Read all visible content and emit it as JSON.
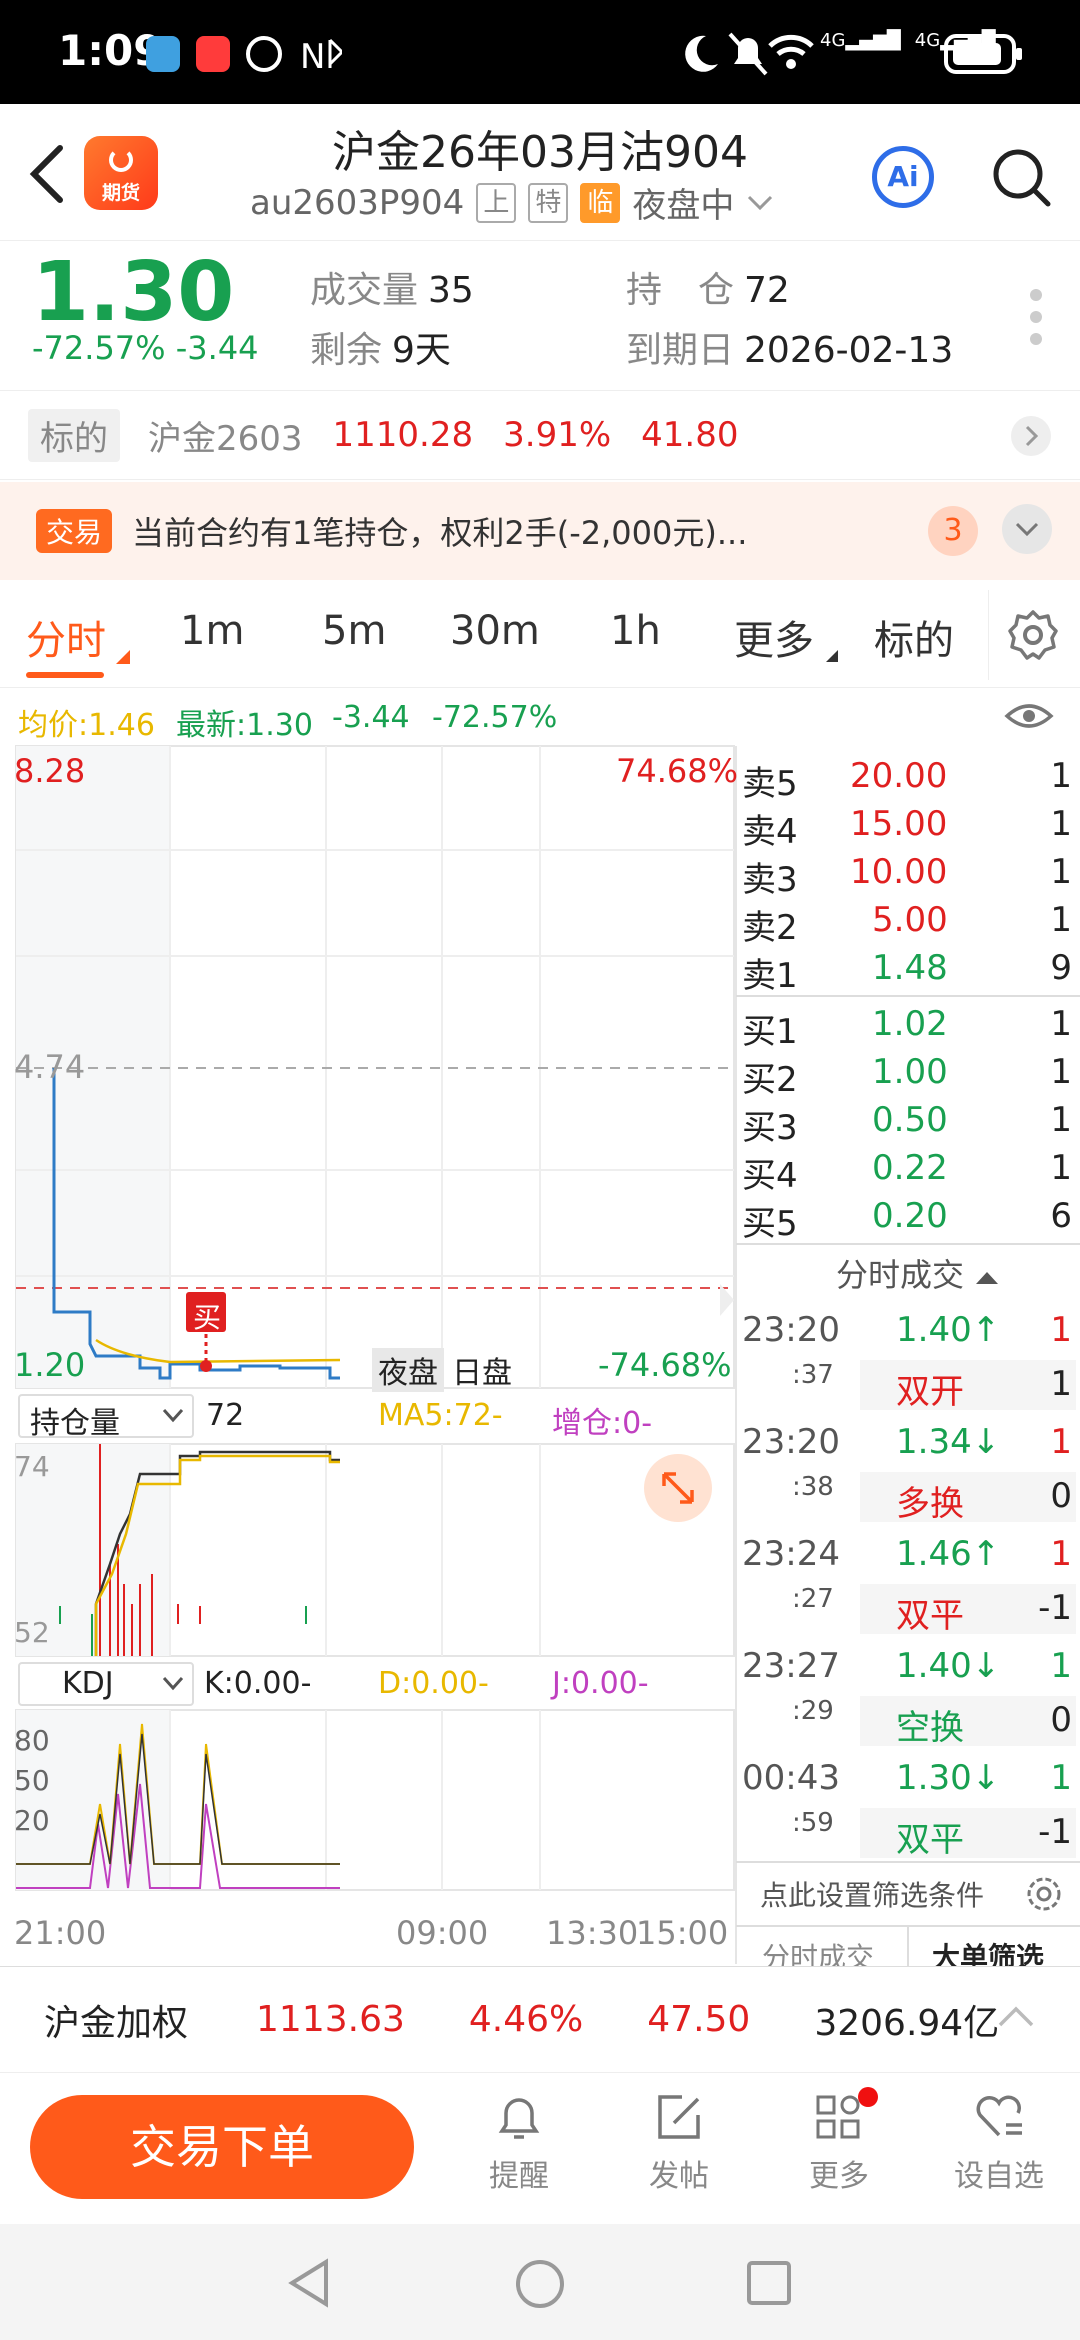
{
  "status_bar": {
    "time": "1:09",
    "net_labels": [
      "4G",
      "4G"
    ]
  },
  "header": {
    "logo_label": "期货",
    "title": "沪金26年03月沽904",
    "code": "au2603P904",
    "tags": [
      "上",
      "特",
      "临"
    ],
    "session": "夜盘中",
    "ai_label": "Ai"
  },
  "quote": {
    "price": "1.30",
    "change_pct": "-72.57%",
    "change": "-3.44",
    "volume_label": "成交量",
    "volume": "35",
    "remain_label": "剩余",
    "remain": "9天",
    "oi_label": "持　仓",
    "oi": "72",
    "expiry_label": "到期日",
    "expiry": "2026-02-13"
  },
  "underlying": {
    "tag": "标的",
    "name": "沪金2603",
    "price": "1110.28",
    "pct": "3.91%",
    "chg": "41.80"
  },
  "banner": {
    "tag": "交易",
    "text": "当前合约有1笔持仓，权利2手(-2,000元)...",
    "count": "3"
  },
  "tabs": [
    "分时",
    "1m",
    "5m",
    "30m",
    "1h",
    "更多",
    "标的"
  ],
  "avg_row": {
    "avg": "均价:1.46",
    "latest": "最新:1.30",
    "chg": "-3.44",
    "pct": "-72.57%"
  },
  "price_chart": {
    "y_top": "8.28",
    "y_mid": "4.74",
    "y_bottom": "1.20",
    "pct_top": "74.68%",
    "pct_bottom": "-74.68%",
    "buy_marker": "买",
    "session_night": "夜盘",
    "session_day": "日盘"
  },
  "oi_panel": {
    "selector": "持仓量",
    "value": "72",
    "ma5": "MA5:72-",
    "incr": "增仓:0-",
    "y_top": "74",
    "y_bottom": "52"
  },
  "kdj_panel": {
    "selector": "KDJ",
    "k": "K:0.00-",
    "d": "D:0.00-",
    "j": "J:0.00-",
    "levels": [
      "80",
      "50",
      "20"
    ]
  },
  "time_axis": [
    "21:00",
    "09:00",
    "13:30",
    "15:00"
  ],
  "order_book": {
    "asks": [
      {
        "label": "卖5",
        "price": "20.00",
        "qty": "1",
        "color": "red"
      },
      {
        "label": "卖4",
        "price": "15.00",
        "qty": "1",
        "color": "red"
      },
      {
        "label": "卖3",
        "price": "10.00",
        "qty": "1",
        "color": "red"
      },
      {
        "label": "卖2",
        "price": "5.00",
        "qty": "1",
        "color": "red"
      },
      {
        "label": "卖1",
        "price": "1.48",
        "qty": "9",
        "color": "green"
      }
    ],
    "bids": [
      {
        "label": "买1",
        "price": "1.02",
        "qty": "1",
        "color": "green"
      },
      {
        "label": "买2",
        "price": "1.00",
        "qty": "1",
        "color": "green"
      },
      {
        "label": "买3",
        "price": "0.50",
        "qty": "1",
        "color": "green"
      },
      {
        "label": "买4",
        "price": "0.22",
        "qty": "1",
        "color": "green"
      },
      {
        "label": "买5",
        "price": "0.20",
        "qty": "6",
        "color": "green"
      }
    ]
  },
  "ticks": {
    "title": "分时成交",
    "rows": [
      {
        "time": "23:20",
        "sec": ":37",
        "price": "1.40↑",
        "price_color": "green",
        "vol": "1",
        "vol_color": "red",
        "type": "双开",
        "type_color": "red",
        "oi_chg": "1"
      },
      {
        "time": "23:20",
        "sec": ":38",
        "price": "1.34↓",
        "price_color": "green",
        "vol": "1",
        "vol_color": "red",
        "type": "多换",
        "type_color": "red",
        "oi_chg": "0"
      },
      {
        "time": "23:24",
        "sec": ":27",
        "price": "1.46↑",
        "price_color": "green",
        "vol": "1",
        "vol_color": "red",
        "type": "双平",
        "type_color": "red",
        "oi_chg": "-1"
      },
      {
        "time": "23:27",
        "sec": ":29",
        "price": "1.40↓",
        "price_color": "green",
        "vol": "1",
        "vol_color": "green",
        "type": "空换",
        "type_color": "green",
        "oi_chg": "0"
      },
      {
        "time": "00:43",
        "sec": ":59",
        "price": "1.30↓",
        "price_color": "green",
        "vol": "1",
        "vol_color": "green",
        "type": "双平",
        "type_color": "green",
        "oi_chg": "-1"
      }
    ],
    "filter": "点此设置筛选条件",
    "tab1": "分时成交",
    "tab2": "大单筛选"
  },
  "index_row": {
    "name": "沪金加权",
    "price": "1113.63",
    "pct": "4.46%",
    "chg": "47.50",
    "amount": "3206.94亿"
  },
  "action_bar": {
    "order": "交易下单",
    "remind": "提醒",
    "post": "发帖",
    "more": "更多",
    "watch": "设自选"
  },
  "colors": {
    "accent": "#ff5a1a",
    "up": "#e02020",
    "down": "#18a050",
    "avg_line": "#e8b800"
  }
}
